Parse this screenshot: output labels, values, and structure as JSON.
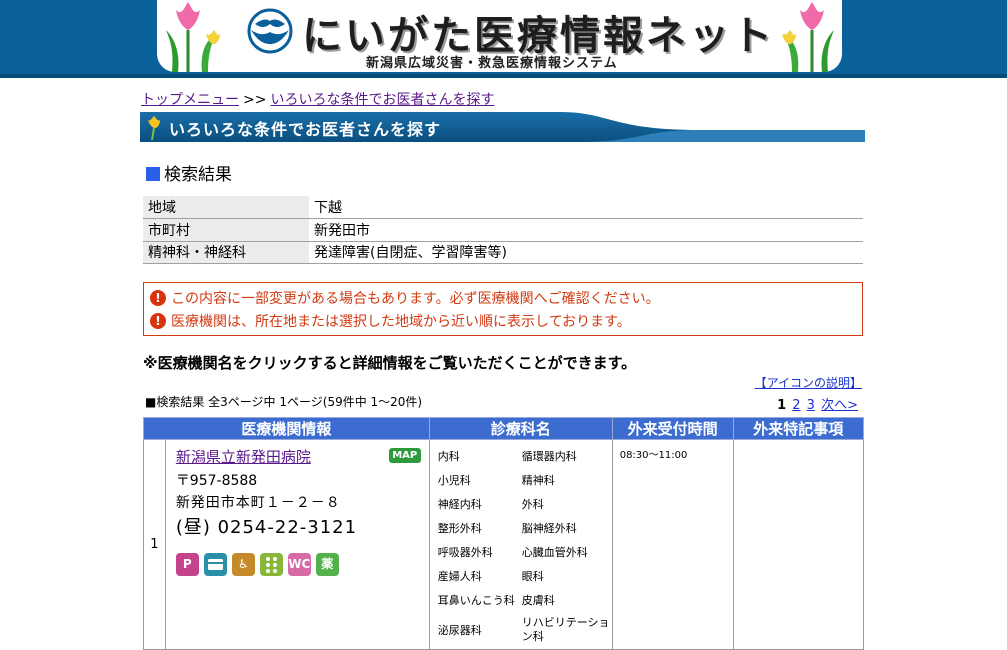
{
  "header": {
    "title": "にいがた医療情報ネット",
    "subtitle": "新潟県広域災害・救急医療情報システム",
    "colors": {
      "banner": "#0b6199",
      "accent": "#3c6cd0"
    }
  },
  "breadcrumb": {
    "top_menu": "トップメニュー",
    "separator": ">>",
    "current": "いろいろな条件でお医者さんを探す"
  },
  "section_title": "いろいろな条件でお医者さんを探す",
  "results_heading": "検索結果",
  "conditions": [
    {
      "key": "地域",
      "value": "下越"
    },
    {
      "key": "市町村",
      "value": "新発田市"
    },
    {
      "key": "精神科・神経科",
      "value": "発達障害(自閉症、学習障害等)"
    }
  ],
  "notices": [
    "この内容に一部変更がある場合もあります。必ず医療機関へご確認ください。",
    "医療機関は、所在地または選択した地域から近い順に表示しております。"
  ],
  "instruction": "※医療機関名をクリックすると詳細情報をご覧いただくことができます。",
  "icon_explanation_link": "【アイコンの説明】",
  "result_count": "■検索結果 全3ページ中 1ページ(59件中 1～20件)",
  "pager": {
    "current": "1",
    "page2": "2",
    "page3": "3",
    "next": "次へ>"
  },
  "table": {
    "headers": [
      "医療機関情報",
      "診療科名",
      "外来受付時間",
      "外来特記事項"
    ],
    "rows": [
      {
        "no": "1",
        "name": "新潟県立新発田病院",
        "map_label": "MAP",
        "zip": "〒957-8588",
        "address": "新発田市本町１－２－８",
        "tel": "(昼) 0254-22-3121",
        "facility_icons": [
          "parking-icon",
          "card-icon",
          "wheelchair-icon",
          "braille-icon",
          "wheelchair-toilet-icon",
          "pharmacy-icon"
        ],
        "facility_labels": {
          "p": "P",
          "med": "薬",
          "wc": "♿",
          "wct": "WC"
        },
        "departments": [
          "内科",
          "循環器内科",
          "小児科",
          "精神科",
          "神経内科",
          "外科",
          "整形外科",
          "脳神経外科",
          "呼吸器外科",
          "心臓血管外科",
          "産婦人科",
          "眼科",
          "耳鼻いんこう科",
          "皮膚科",
          "泌尿器科",
          "リハビリテーション科"
        ],
        "hours": "08:30～11:00",
        "notes": ""
      }
    ]
  }
}
